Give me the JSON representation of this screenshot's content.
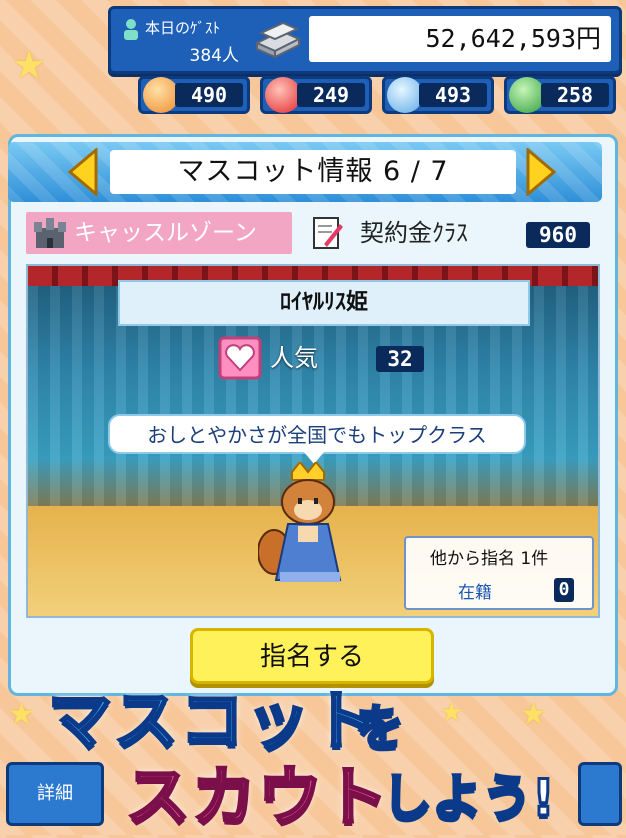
{
  "header": {
    "guest_label": "本日のｹﾞｽﾄ",
    "guest_count": "384人",
    "money": "52,642,593円"
  },
  "gauges": [
    {
      "icon": "smile-orb-icon",
      "color": "#f6a04a",
      "value": "490"
    },
    {
      "icon": "fire-orb-icon",
      "color": "#ff4d4d",
      "value": "249"
    },
    {
      "icon": "water-orb-icon",
      "color": "#79c6ff",
      "value": "493"
    },
    {
      "icon": "leaf-orb-icon",
      "color": "#3fbf4a",
      "value": "258"
    }
  ],
  "panel": {
    "title": "マスコット情報 6 / 7",
    "zone_label": "キャッスルゾーン",
    "fee_label": "契約金ｸﾗｽ",
    "fee_value": "960"
  },
  "mascot": {
    "name": "ﾛｲﾔﾙﾘｽ姫",
    "popularity_label": "人気",
    "popularity_value": "32",
    "description": "おしとやかさが全国でもトップクラス",
    "offers_label": "他から指名 1件",
    "enrolled_label": "在籍",
    "enrolled_value": "0"
  },
  "actions": {
    "scout_button": "指名する",
    "detail_button": "詳細"
  },
  "promo": {
    "line1": "マスコット",
    "line1_suffix": "を",
    "line2": "スカウト",
    "line2_suffix": "しよう!"
  }
}
